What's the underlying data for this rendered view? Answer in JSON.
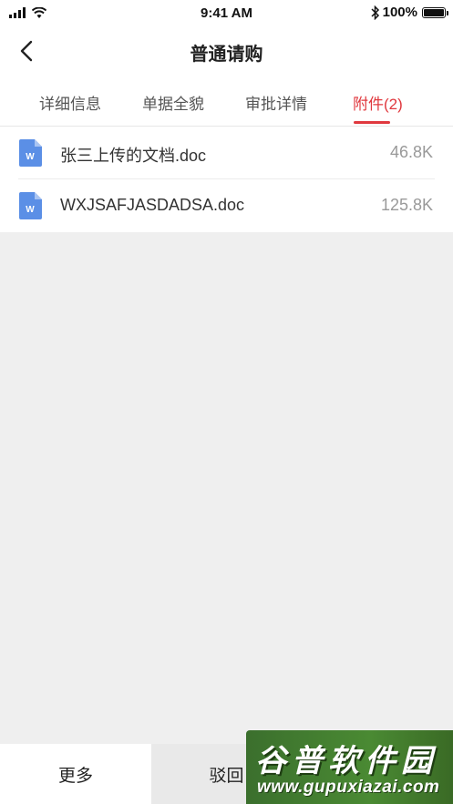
{
  "status_bar": {
    "time": "9:41 AM",
    "battery": "100%",
    "icons": [
      "signal-icon",
      "wifi-icon",
      "bluetooth-icon",
      "battery-icon"
    ]
  },
  "nav": {
    "title": "普通请购",
    "back_icon": "chevron-left-icon"
  },
  "tabs": [
    {
      "label": "详细信息",
      "active": false
    },
    {
      "label": "单据全貌",
      "active": false
    },
    {
      "label": "审批详情",
      "active": false
    },
    {
      "label": "附件(2)",
      "active": true
    }
  ],
  "attachments": [
    {
      "name": "张三上传的文档.doc",
      "size": "46.8K",
      "icon": "word-file-icon"
    },
    {
      "name": "WXJSAFJASDADSA.doc",
      "size": "125.8K",
      "icon": "word-file-icon"
    }
  ],
  "actions": {
    "more": "更多",
    "reject": "驳回"
  },
  "watermark": {
    "title": "谷普软件园",
    "url": "www.gupuxiazai.com"
  },
  "colors": {
    "accent": "#e0383e",
    "file_icon": "#5b8fe6",
    "background": "#efefef"
  }
}
